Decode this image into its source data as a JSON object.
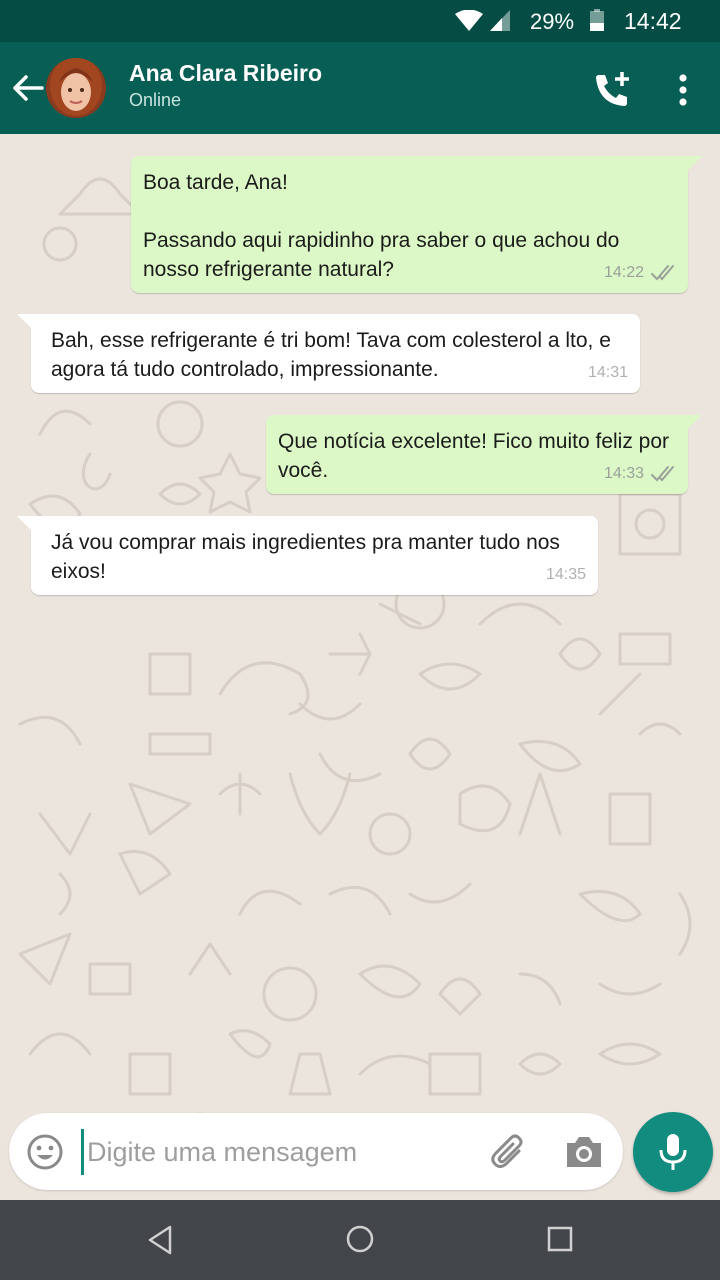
{
  "status_bar": {
    "battery_percent": "29%",
    "time": "14:42"
  },
  "header": {
    "contact_name": "Ana Clara Ribeiro",
    "contact_status": "Online",
    "back_icon": "arrow-left-icon",
    "call_icon": "add-call-icon",
    "menu_icon": "more-vert-icon"
  },
  "messages": [
    {
      "direction": "out",
      "text": "Boa tarde, Ana!\n\nPassando aqui rapidinho pra saber o que achou do nosso refrigerante natural?",
      "time": "14:22",
      "ticks": "double-check-icon"
    },
    {
      "direction": "in",
      "text": "Bah, esse refrigerante é tri bom! Tava com colesterol a lto, e agora tá tudo controlado, impressionante.",
      "time": "14:31"
    },
    {
      "direction": "out",
      "text": "Que notícia excelente! Fico muito feliz por você.",
      "time": "14:33",
      "ticks": "double-check-icon"
    },
    {
      "direction": "in",
      "text": "Já vou comprar mais ingredientes pra manter tudo nos eixos!",
      "time": "14:35"
    }
  ],
  "composer": {
    "placeholder": "Digite uma mensagem",
    "value": ""
  },
  "colors": {
    "status_bar": "#054d44",
    "app_bar": "#075e54",
    "outgoing_bubble": "#dcf8c6",
    "incoming_bubble": "#ffffff",
    "chat_background": "#ece5dd",
    "accent": "#128c7e",
    "nav_bar": "#42464a"
  }
}
